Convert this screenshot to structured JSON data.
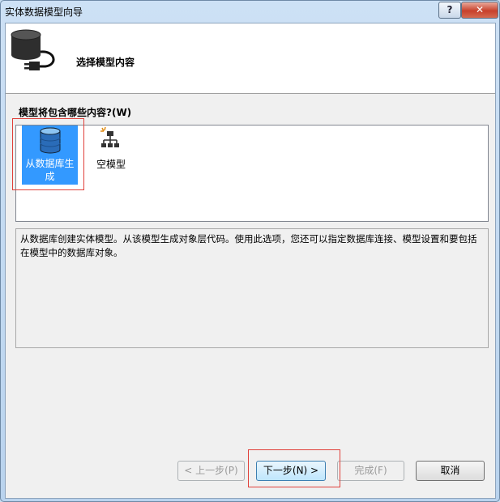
{
  "window": {
    "title": "实体数据模型向导",
    "help_label": "?",
    "close_label": "✕"
  },
  "header": {
    "title": "选择模型内容",
    "icon": "database-plug-icon"
  },
  "question_label": "模型将包含哪些内容?(W)",
  "model_options": [
    {
      "label": "从数据库生成",
      "icon": "database-icon",
      "selected": true
    },
    {
      "label": "空模型",
      "icon": "empty-model-icon",
      "selected": false
    }
  ],
  "description": "从数据库创建实体模型。从该模型生成对象层代码。使用此选项，您还可以指定数据库连接、模型设置和要包括在模型中的数据库对象。",
  "buttons": {
    "prev": "< 上一步(P)",
    "next": "下一步(N) >",
    "finish": "完成(F)",
    "cancel": "取消"
  },
  "colors": {
    "selection": "#3399ff",
    "highlight_box": "#e0403a"
  }
}
